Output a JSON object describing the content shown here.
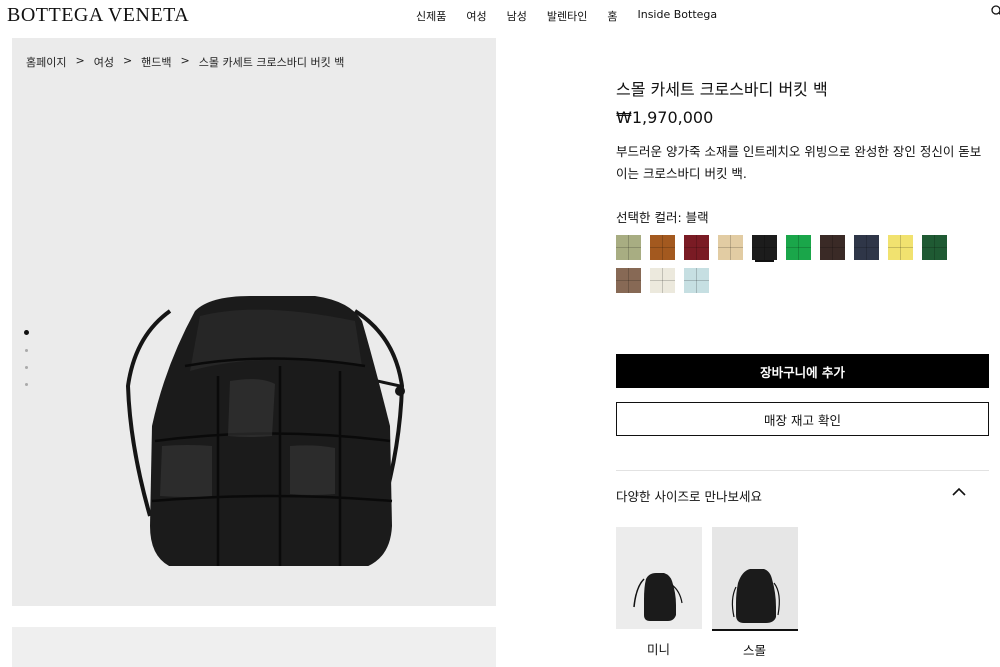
{
  "header": {
    "logo": "BOTTEGA VENETA",
    "nav": [
      "신제품",
      "여성",
      "남성",
      "발렌타인",
      "홈",
      "Inside Bottega"
    ],
    "search_icon": "search-icon"
  },
  "breadcrumb": {
    "items": [
      "홈페이지",
      "여성",
      "핸드백",
      "스몰 카세트 크로스바디 버킷 백"
    ],
    "separator": ">"
  },
  "product": {
    "title": "스몰 카세트 크로스바디 버킷 백",
    "price": "₩1,970,000",
    "description": "부드러운 양가죽 소재를 인트레치오 위빙으로 완성한 장인 정신이 돋보이는 크로스바디 버킷 백.",
    "color_label": "선택한 컬러: 블랙",
    "swatches": [
      {
        "color": "#a8ad82"
      },
      {
        "color": "#a3591f"
      },
      {
        "color": "#7a1b24"
      },
      {
        "color": "#e2cca3"
      },
      {
        "color": "#1c1c1c",
        "selected": true
      },
      {
        "color": "#1aa64a"
      },
      {
        "color": "#3a2a26"
      },
      {
        "color": "#2f3648"
      },
      {
        "color": "#f1e26f"
      },
      {
        "color": "#1f5a33"
      },
      {
        "color": "#876955"
      },
      {
        "color": "#ece9dd"
      },
      {
        "color": "#c6dfe2"
      }
    ]
  },
  "actions": {
    "add_to_cart": "장바구니에 추가",
    "check_store": "매장 재고 확인"
  },
  "sizes": {
    "title": "다양한 사이즈로 만나보세요",
    "items": [
      {
        "label": "미니",
        "selected": false
      },
      {
        "label": "스몰",
        "selected": true
      }
    ]
  },
  "gallery": {
    "slide_count": 4,
    "active_slide": 1
  }
}
